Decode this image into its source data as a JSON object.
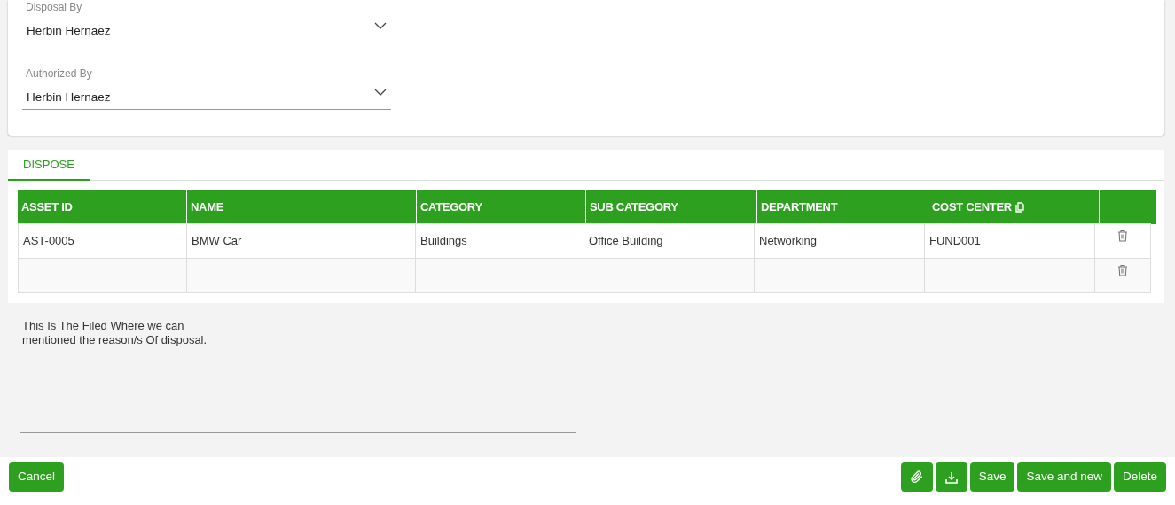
{
  "fields": [
    {
      "label": "Disposal By",
      "value": "Herbin Hernaez"
    },
    {
      "label": "Authorized By",
      "value": "Herbin Hernaez"
    }
  ],
  "tabs": [
    {
      "label": "DISPOSE",
      "selected": true
    }
  ],
  "table": {
    "columns": [
      {
        "label": "ASSET ID"
      },
      {
        "label": "NAME"
      },
      {
        "label": "CATEGORY"
      },
      {
        "label": "SUB CATEGORY"
      },
      {
        "label": "DEPARTMENT"
      },
      {
        "label": "COST CENTER",
        "copy_icon": true
      }
    ],
    "rows": [
      {
        "kind": "data",
        "cells": [
          "AST-0005",
          "BMW Car",
          "Buildings",
          "Office Building",
          "Networking",
          "FUND001"
        ]
      },
      {
        "kind": "blank"
      }
    ]
  },
  "reason": {
    "value": "This Is The Filed Where we can\nmentioned the reason/s Of disposal."
  },
  "footer": {
    "left": [
      {
        "kind": "text",
        "label": "Cancel"
      }
    ],
    "right": [
      {
        "kind": "attach"
      },
      {
        "kind": "download"
      },
      {
        "kind": "text",
        "label": "Save"
      },
      {
        "kind": "text",
        "label": "Save and new"
      },
      {
        "kind": "text",
        "label": "Delete"
      }
    ]
  }
}
